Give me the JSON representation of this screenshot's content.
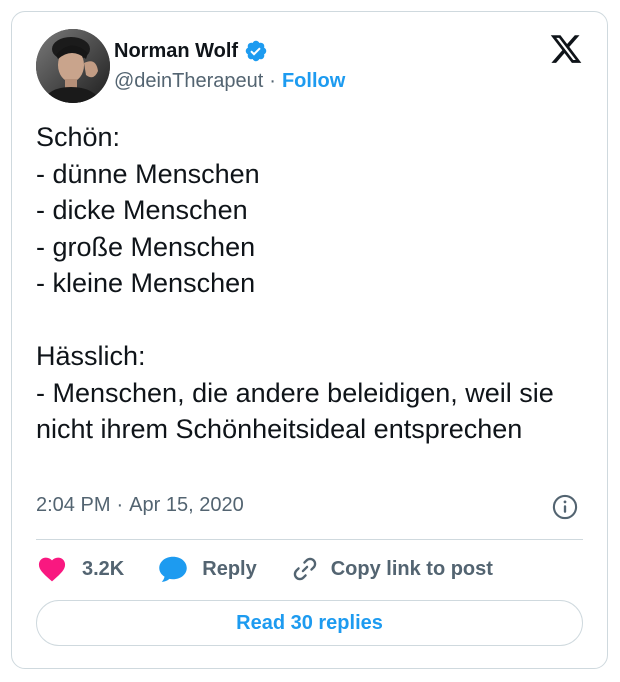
{
  "author": {
    "display_name": "Norman Wolf",
    "handle": "@deinTherapeut",
    "separator": "·",
    "follow_label": "Follow",
    "verified": true
  },
  "tweet": {
    "text": "Schön:\n- dünne Menschen\n- dicke Menschen\n- große Menschen\n- kleine Menschen\n\nHässlich:\n- Menschen, die andere beleidigen, weil sie nicht ihrem Schönheitsideal entsprechen",
    "time": "2:04 PM",
    "separator": "·",
    "date": "Apr 15, 2020"
  },
  "actions": {
    "like_count": "3.2K",
    "reply_label": "Reply",
    "copy_link_label": "Copy link to post"
  },
  "footer": {
    "read_replies_label": "Read 30 replies"
  },
  "icons": {
    "brand": "x-logo-icon",
    "verified": "verified-badge-icon",
    "info": "info-icon",
    "like": "heart-icon",
    "reply": "speech-bubble-icon",
    "copy": "link-icon"
  },
  "colors": {
    "accent": "#1d9bf0",
    "like": "#f91880",
    "text": "#0f1419",
    "secondary_text": "#536471",
    "border": "#cfd9de"
  }
}
